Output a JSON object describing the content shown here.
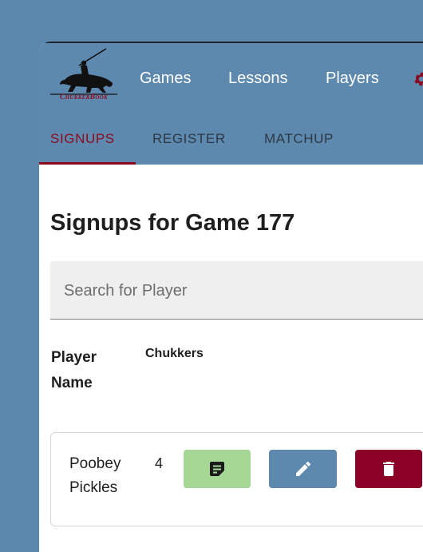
{
  "brand": {
    "logo_text": "ChukkerBook",
    "accent": "#8b0a1f",
    "nav_bg": "#5e89ae",
    "page_bg": "#5b87ab"
  },
  "nav": {
    "links": [
      "Games",
      "Lessons",
      "Players"
    ],
    "gear_icon": "gear-icon"
  },
  "tabs": [
    {
      "label": "SIGNUPS",
      "active": true
    },
    {
      "label": "REGISTER",
      "active": false
    },
    {
      "label": "MATCHUP",
      "active": false
    }
  ],
  "main": {
    "title": "Signups for Game 177",
    "search": {
      "placeholder": "Search for Player",
      "value": ""
    },
    "table": {
      "headers": {
        "player": "Player Name",
        "chukkers": "Chukkers"
      },
      "rows": [
        {
          "player": "Poobey Pickles",
          "chukkers": "4",
          "actions": [
            {
              "icon": "notes-icon",
              "color": "#a6d795"
            },
            {
              "icon": "pencil-icon",
              "color": "#5e89ae"
            },
            {
              "icon": "trash-icon",
              "color": "#8b0024"
            }
          ]
        }
      ]
    }
  }
}
